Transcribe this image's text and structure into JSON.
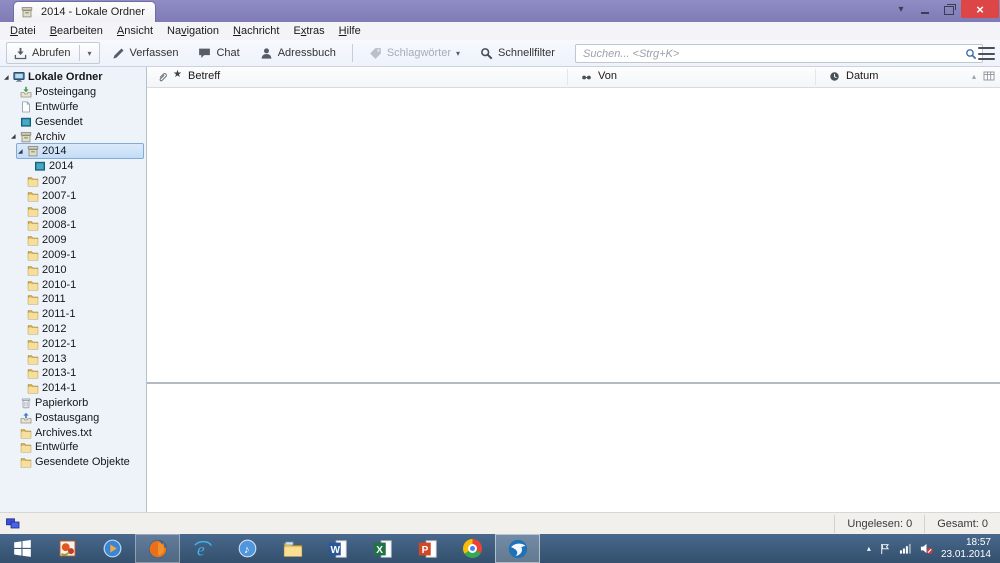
{
  "window": {
    "title": "2014 - Lokale Ordner",
    "tab_list_glyph": "▾",
    "close_glyph": "×"
  },
  "menubar": {
    "items": [
      {
        "label": "Datei",
        "ukey": 0
      },
      {
        "label": "Bearbeiten",
        "ukey": 0
      },
      {
        "label": "Ansicht",
        "ukey": 0
      },
      {
        "label": "Navigation",
        "ukey": 2
      },
      {
        "label": "Nachricht",
        "ukey": 0
      },
      {
        "label": "Extras",
        "ukey": 1
      },
      {
        "label": "Hilfe",
        "ukey": 0
      }
    ]
  },
  "toolbar": {
    "buttons": [
      {
        "label": "Abrufen",
        "icon": "get-mail",
        "split": true
      },
      {
        "label": "Verfassen",
        "icon": "compose"
      },
      {
        "label": "Chat",
        "icon": "chat"
      },
      {
        "label": "Adressbuch",
        "icon": "address-book"
      },
      {
        "separator": true
      },
      {
        "label": "Schlagwörter",
        "icon": "tag",
        "disabled": true,
        "dropdown": true
      },
      {
        "label": "Schnellfilter",
        "icon": "quick-filter"
      }
    ],
    "search": {
      "placeholder": "Suchen... <Strg+K>"
    }
  },
  "folder_pane": {
    "twisty_glyph": "◢",
    "items": [
      {
        "label": "Lokale Ordner",
        "icon": "computer",
        "level": 0,
        "twisty": true,
        "bold": true
      },
      {
        "label": "Posteingang",
        "icon": "inbox",
        "level": 1
      },
      {
        "label": "Entwürfe",
        "icon": "draft",
        "level": 1
      },
      {
        "label": "Gesendet",
        "icon": "sent",
        "level": 1
      },
      {
        "label": "Archiv",
        "icon": "archive",
        "level": 1,
        "twisty": true
      },
      {
        "label": "2014",
        "icon": "archive",
        "level": 2,
        "twisty": true,
        "selected": true
      },
      {
        "label": "2014",
        "icon": "sent",
        "level": 3
      },
      {
        "label": "2007",
        "icon": "folder",
        "level": 2
      },
      {
        "label": "2007-1",
        "icon": "folder",
        "level": 2
      },
      {
        "label": "2008",
        "icon": "folder",
        "level": 2
      },
      {
        "label": "2008-1",
        "icon": "folder",
        "level": 2
      },
      {
        "label": "2009",
        "icon": "folder",
        "level": 2
      },
      {
        "label": "2009-1",
        "icon": "folder",
        "level": 2
      },
      {
        "label": "2010",
        "icon": "folder",
        "level": 2
      },
      {
        "label": "2010-1",
        "icon": "folder",
        "level": 2
      },
      {
        "label": "2011",
        "icon": "folder",
        "level": 2
      },
      {
        "label": "2011-1",
        "icon": "folder",
        "level": 2
      },
      {
        "label": "2012",
        "icon": "folder",
        "level": 2
      },
      {
        "label": "2012-1",
        "icon": "folder",
        "level": 2
      },
      {
        "label": "2013",
        "icon": "folder",
        "level": 2
      },
      {
        "label": "2013-1",
        "icon": "folder",
        "level": 2
      },
      {
        "label": "2014-1",
        "icon": "folder",
        "level": 2
      },
      {
        "label": "Papierkorb",
        "icon": "trash",
        "level": 1
      },
      {
        "label": "Postausgang",
        "icon": "outbox",
        "level": 1
      },
      {
        "label": "Archives.txt",
        "icon": "folder",
        "level": 1
      },
      {
        "label": "Entwürfe",
        "icon": "folder",
        "level": 1
      },
      {
        "label": "Gesendete Objekte",
        "icon": "folder",
        "level": 1
      }
    ]
  },
  "thread_pane": {
    "columns": {
      "betreff": "Betreff",
      "von": "Von",
      "datum": "Datum"
    },
    "sort_glyph": "▴"
  },
  "statusbar": {
    "unread": "Ungelesen: 0",
    "total": "Gesamt: 0"
  },
  "taskbar": {
    "apps": [
      {
        "name": "start"
      },
      {
        "name": "photos"
      },
      {
        "name": "media-player"
      },
      {
        "name": "firefox",
        "open": true
      },
      {
        "name": "internet-explorer"
      },
      {
        "name": "itunes"
      },
      {
        "name": "file-explorer"
      },
      {
        "name": "word"
      },
      {
        "name": "excel"
      },
      {
        "name": "powerpoint"
      },
      {
        "name": "chrome"
      },
      {
        "name": "thunderbird",
        "open": true,
        "active": true
      }
    ],
    "tray": {
      "hidden_icons_glyph": "▴",
      "time": "18:57",
      "date": "23.01.2014"
    }
  },
  "colors": {
    "titlebar": "#908dc5",
    "titlebar-dark": "#7e7bb5",
    "close-red": "#dc4646",
    "toolbar-bg": "#eef3fb",
    "sidebar-bg": "#eef3fa",
    "selection-border": "#84abd8",
    "selection-bg1": "#dcebfb",
    "selection-bg2": "#c3ddf6",
    "statusbar-bg": "#f1f0ed",
    "taskbar-bg": "#3c5a7a"
  }
}
